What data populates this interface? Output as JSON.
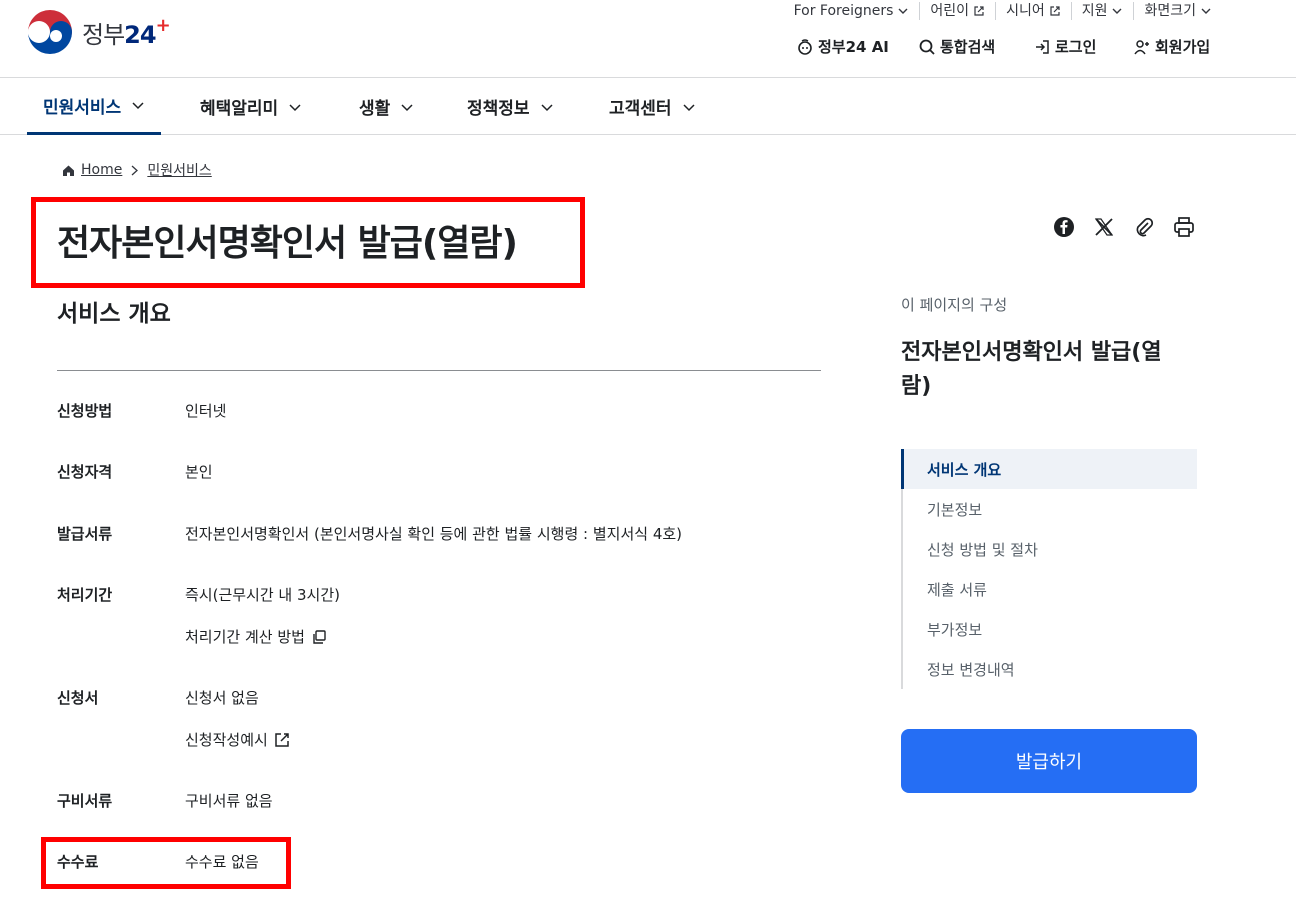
{
  "header": {
    "logo_text": "정부",
    "logo_num": "24",
    "logo_plus": "+",
    "util": [
      {
        "label": "For Foreigners"
      },
      {
        "label": "어린이"
      },
      {
        "label": "시니어"
      },
      {
        "label": "지원"
      },
      {
        "label": "화면크기"
      }
    ],
    "actions": {
      "ai": "정부24 AI",
      "search": "통합검색",
      "login": "로그인",
      "signup": "회원가입"
    }
  },
  "gnb": [
    {
      "label": "민원서비스"
    },
    {
      "label": "혜택알리미"
    },
    {
      "label": "생활"
    },
    {
      "label": "정책정보"
    },
    {
      "label": "고객센터"
    }
  ],
  "breadcrumb": {
    "home": "Home",
    "current": "민원서비스"
  },
  "page": {
    "title": "전자본인서명확인서 발급(열람)",
    "section_title": "서비스 개요"
  },
  "details": [
    {
      "label": "신청방법",
      "value": "인터넷"
    },
    {
      "label": "신청자격",
      "value": "본인"
    },
    {
      "label": "발급서류",
      "value": "전자본인서명확인서 (본인서명사실 확인 등에 관한 법률 시행령 : 별지서식 4호)"
    },
    {
      "label": "처리기간",
      "value": "즉시(근무시간 내 3시간)",
      "link": "처리기간 계산 방법"
    },
    {
      "label": "신청서",
      "value": "신청서 없음",
      "link": "신청작성예시"
    },
    {
      "label": "구비서류",
      "value": "구비서류 없음"
    },
    {
      "label": "수수료",
      "value": "수수료 없음"
    }
  ],
  "toc": {
    "caption": "이 페이지의 구성",
    "title": "전자본인서명확인서 발급(열람)",
    "items": [
      {
        "label": "서비스 개요"
      },
      {
        "label": "기본정보"
      },
      {
        "label": "신청 방법 및 절차"
      },
      {
        "label": "제출 서류"
      },
      {
        "label": "부가정보"
      },
      {
        "label": "정보 변경내역"
      }
    ]
  },
  "issue_button": "발급하기",
  "colors": {
    "primary": "#256ef4",
    "navy": "#003675",
    "highlight": "#ff0000"
  }
}
